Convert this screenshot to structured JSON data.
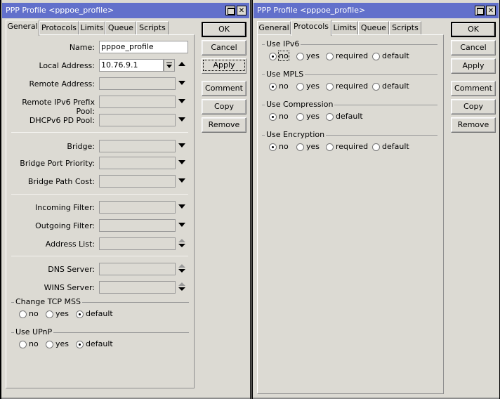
{
  "windows": [
    {
      "title": "PPP Profile <pppoe_profile>",
      "active_tab": "General",
      "tabs": [
        "General",
        "Protocols",
        "Limits",
        "Queue",
        "Scripts"
      ],
      "buttons": [
        "OK",
        "Cancel",
        "Apply",
        "Comment",
        "Copy",
        "Remove"
      ],
      "general": {
        "name_label": "Name:",
        "name_value": "pppoe_profile",
        "local_address_label": "Local Address:",
        "local_address_value": "10.76.9.1",
        "remote_address_label": "Remote Address:",
        "remote_address_value": "",
        "remote_ipv6_label": "Remote IPv6 Prefix Pool:",
        "remote_ipv6_value": "",
        "dhcpv6_label": "DHCPv6 PD Pool:",
        "dhcpv6_value": "",
        "bridge_label": "Bridge:",
        "bridge_value": "",
        "bridge_port_priority_label": "Bridge Port Priority:",
        "bridge_port_priority_value": "",
        "bridge_path_cost_label": "Bridge Path Cost:",
        "bridge_path_cost_value": "",
        "incoming_filter_label": "Incoming Filter:",
        "incoming_filter_value": "",
        "outgoing_filter_label": "Outgoing Filter:",
        "outgoing_filter_value": "",
        "address_list_label": "Address List:",
        "address_list_value": "",
        "dns_server_label": "DNS Server:",
        "dns_server_value": "",
        "wins_server_label": "WINS Server:",
        "wins_server_value": "",
        "change_tcp_mss": {
          "title": "Change TCP MSS",
          "options": [
            "no",
            "yes",
            "default"
          ],
          "selected": "default"
        },
        "use_upnp": {
          "title": "Use UPnP",
          "options": [
            "no",
            "yes",
            "default"
          ],
          "selected": "default"
        }
      }
    },
    {
      "title": "PPP Profile <pppoe_profile>",
      "active_tab": "Protocols",
      "tabs": [
        "General",
        "Protocols",
        "Limits",
        "Queue",
        "Scripts"
      ],
      "buttons": [
        "OK",
        "Cancel",
        "Apply",
        "Comment",
        "Copy",
        "Remove"
      ],
      "protocols": {
        "use_ipv6": {
          "title": "Use IPv6",
          "options": [
            "no",
            "yes",
            "required",
            "default"
          ],
          "selected": "no"
        },
        "use_mpls": {
          "title": "Use MPLS",
          "options": [
            "no",
            "yes",
            "required",
            "default"
          ],
          "selected": "no"
        },
        "use_compression": {
          "title": "Use Compression",
          "options": [
            "no",
            "yes",
            "default"
          ],
          "selected": "no"
        },
        "use_encryption": {
          "title": "Use Encryption",
          "options": [
            "no",
            "yes",
            "required",
            "default"
          ],
          "selected": "no"
        }
      }
    }
  ],
  "colors": {
    "titlebar": "#6270cb",
    "window_bg": "#dcdad3"
  }
}
